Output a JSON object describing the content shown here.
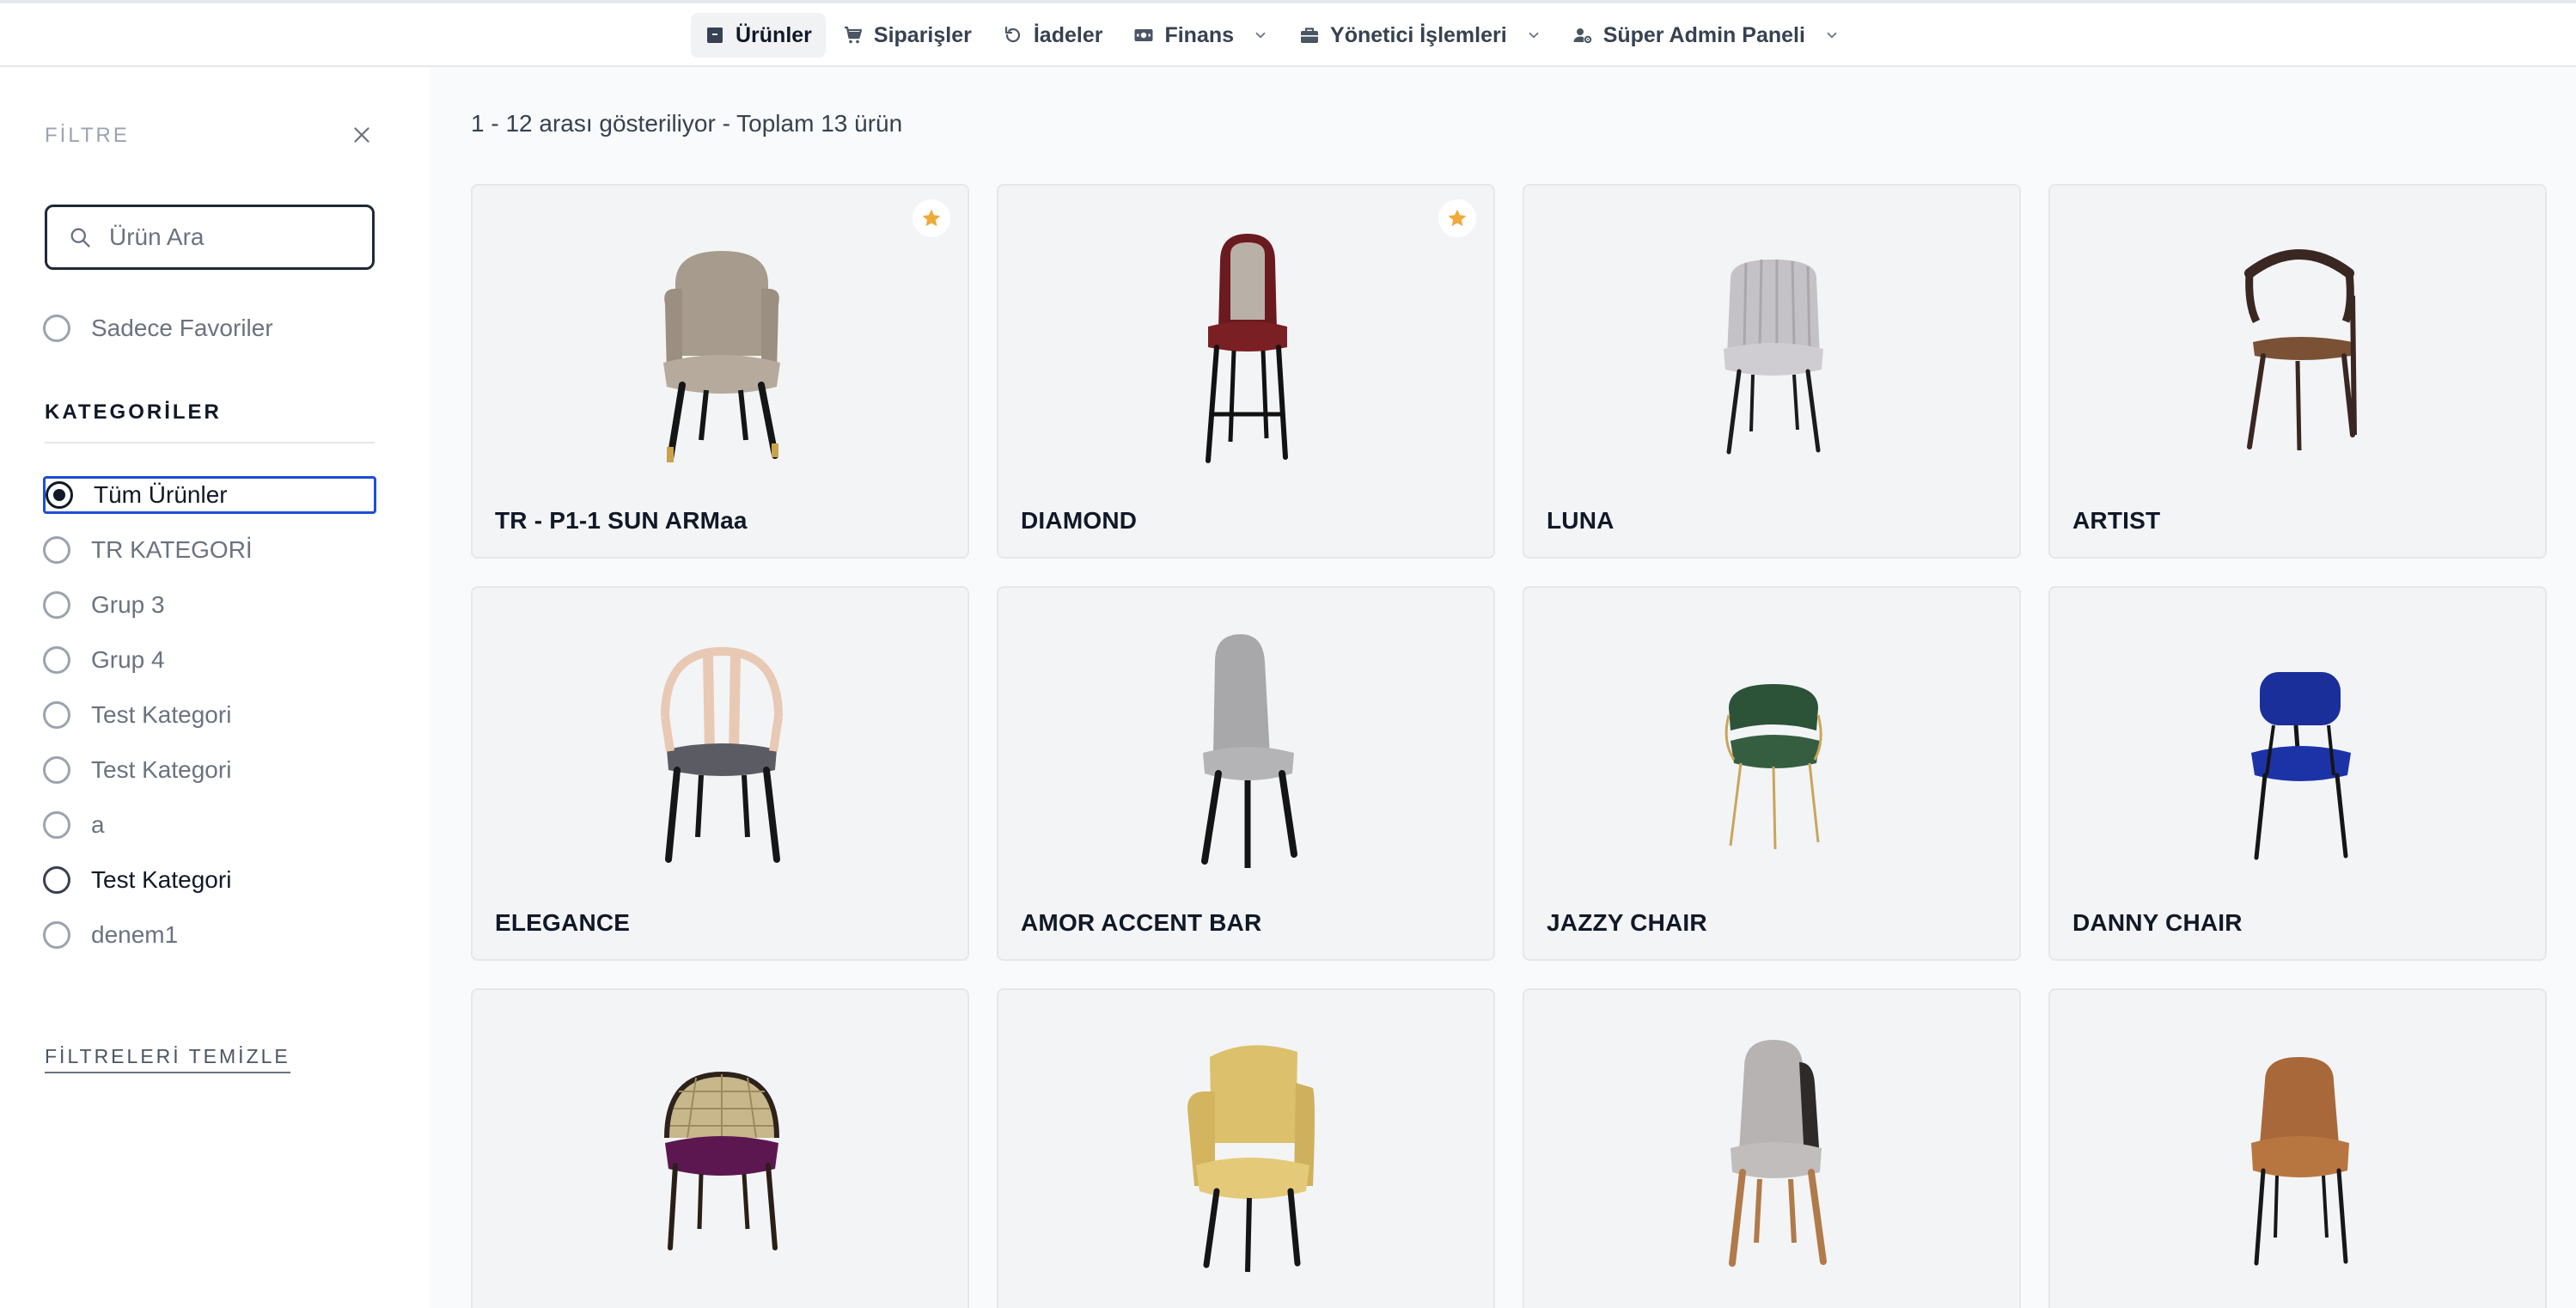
{
  "nav": {
    "items": [
      {
        "label": "Ürünler",
        "icon": "package-icon",
        "active": true
      },
      {
        "label": "Siparişler",
        "icon": "cart-icon"
      },
      {
        "label": "İadeler",
        "icon": "undo-icon"
      },
      {
        "label": "Finans",
        "icon": "money-icon",
        "dropdown": true
      },
      {
        "label": "Yönetici İşlemleri",
        "icon": "briefcase-icon",
        "dropdown": true
      },
      {
        "label": "Süper Admin Paneli",
        "icon": "user-cog-icon",
        "dropdown": true
      }
    ]
  },
  "sidebar": {
    "filter_title": "FİLTRE",
    "close_icon": "close-icon",
    "search_placeholder": "Ürün Ara",
    "favorites_label": "Sadece Favoriler",
    "categories_title": "KATEGORİLER",
    "categories": [
      {
        "label": "Tüm Ürünler",
        "selected": true
      },
      {
        "label": "TR KATEGORİ"
      },
      {
        "label": "Grup 3"
      },
      {
        "label": "Grup 4"
      },
      {
        "label": "Test Kategori"
      },
      {
        "label": "Test Kategori"
      },
      {
        "label": "a"
      },
      {
        "label": "Test Kategori",
        "emphasized": true
      },
      {
        "label": "denem1"
      }
    ],
    "clear_filters": "FİLTRELERİ TEMİZLE"
  },
  "main": {
    "result_text": "1 - 12 arası gösteriliyor - Toplam 13 ürün",
    "products": [
      {
        "name": "TR - P1-1 SUN ARMaa",
        "favorite": true,
        "image": "beige-velvet-armchair"
      },
      {
        "name": "DIAMOND",
        "favorite": true,
        "image": "burgundy-bar-stool"
      },
      {
        "name": "LUNA",
        "favorite": false,
        "image": "grey-channel-chair"
      },
      {
        "name": "ARTIST",
        "favorite": false,
        "image": "walnut-arm-chair"
      },
      {
        "name": "ELEGANCE",
        "favorite": false,
        "image": "light-wood-round-back-chair"
      },
      {
        "name": "AMOR ACCENT BAR",
        "favorite": false,
        "image": "grey-upholstered-chair"
      },
      {
        "name": "JAZZY CHAIR",
        "favorite": false,
        "image": "green-velvet-gold-chair"
      },
      {
        "name": "DANNY CHAIR",
        "favorite": false,
        "image": "blue-velvet-chair"
      },
      {
        "name": "",
        "favorite": false,
        "image": "rattan-purple-seat-chair"
      },
      {
        "name": "",
        "favorite": false,
        "image": "yellow-armchair"
      },
      {
        "name": "",
        "favorite": false,
        "image": "grey-wood-leg-chair"
      },
      {
        "name": "",
        "favorite": false,
        "image": "copper-velvet-chair"
      }
    ]
  },
  "colors": {
    "accent_star": "#f0a93b",
    "focus_blue": "#1d4ed8"
  }
}
